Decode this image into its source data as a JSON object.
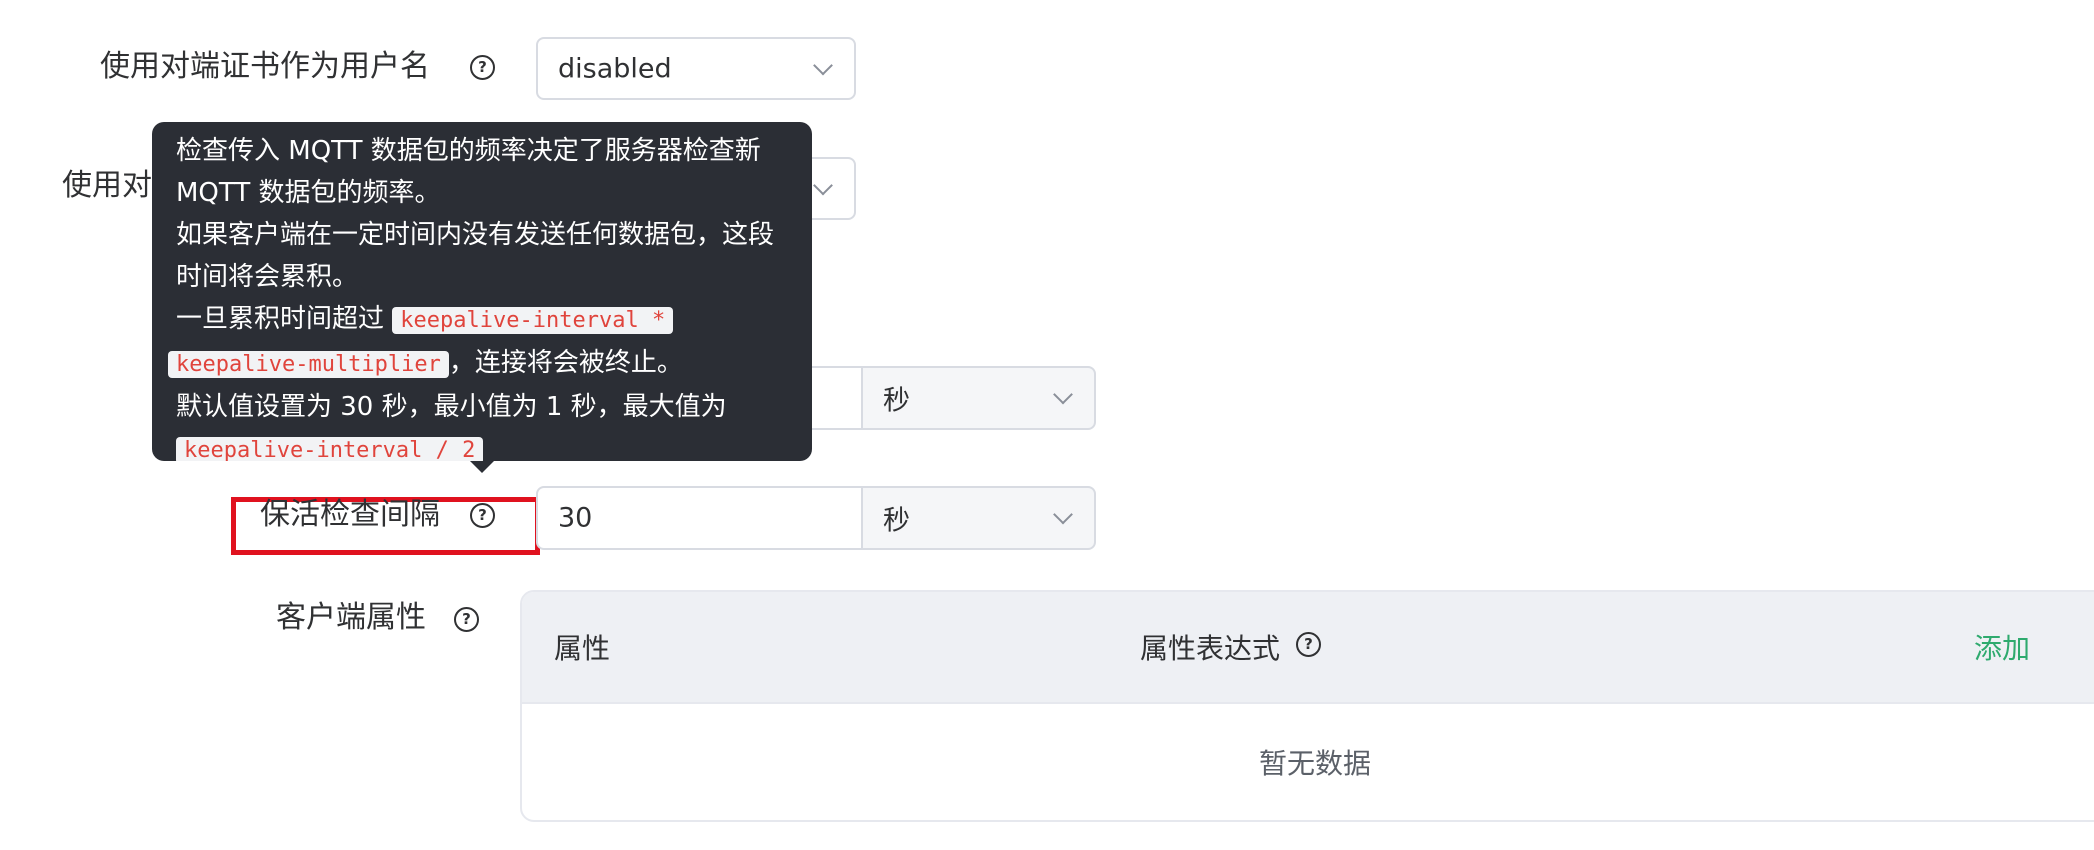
{
  "form": {
    "cert_username": {
      "label": "使用对端证书作为用户名",
      "value": "disabled"
    },
    "second_row": {
      "label_visible": "使用对"
    },
    "keepalive_multiplier_row": {
      "unit": "秒"
    },
    "keepalive_interval": {
      "label": "保活检查间隔",
      "value": "30",
      "unit": "秒"
    },
    "client_attrs": {
      "label": "客户端属性",
      "table": {
        "col_attr": "属性",
        "col_expr": "属性表达式",
        "add": "添加",
        "empty": "暂无数据"
      }
    }
  },
  "tooltip": {
    "line1": "检查传入 MQTT 数据包的频率决定了服务器检查新",
    "line2": "MQTT 数据包的频率。",
    "line3": "如果客户端在一定时间内没有发送任何数据包，这段",
    "line4": "时间将会累积。",
    "line5_prefix": "一旦累积时间超过",
    "code1a": "keepalive-interval *",
    "code1b": "keepalive-multiplier",
    "line6_suffix": "，连接将会被终止。",
    "line7": "默认值设置为 30 秒，最小值为 1 秒，最大值为",
    "code2": "keepalive-interval / 2"
  },
  "icons": {
    "help": "question-circle-icon",
    "dropdown": "chevron-down-icon"
  },
  "colors": {
    "accent_green": "#2eaa6e",
    "highlight_red": "#e0121f",
    "tooltip_bg": "#2b2e35"
  }
}
